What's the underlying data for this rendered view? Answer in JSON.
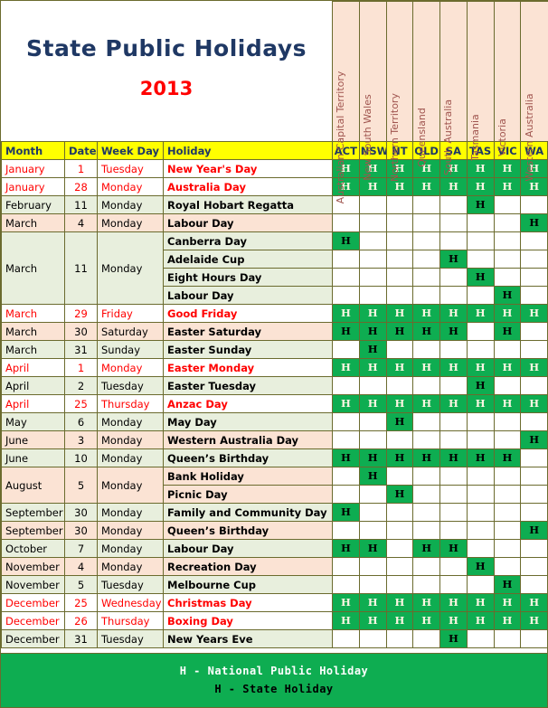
{
  "title": {
    "heading": "State Public Holidays",
    "year": "2013"
  },
  "states": [
    {
      "code": "ACT",
      "full": "Australian Capital Territory"
    },
    {
      "code": "NSW",
      "full": "New South Wales"
    },
    {
      "code": "NT",
      "full": "Northern Territory"
    },
    {
      "code": "QLD",
      "full": "Queensland"
    },
    {
      "code": "SA",
      "full": "South Australia"
    },
    {
      "code": "TAS",
      "full": "Tasmania"
    },
    {
      "code": "VIC",
      "full": "Victoria"
    },
    {
      "code": "WA",
      "full": "Western Australia"
    }
  ],
  "columns": {
    "month": "Month",
    "date": "Date",
    "weekday": "Week Day",
    "holiday": "Holiday"
  },
  "legend": {
    "national": "H - National Public Holiday",
    "state": "H - State Holiday",
    "marker": "H"
  },
  "colors": {
    "title": "#1f3864",
    "year": "#ff0000",
    "header_bg": "#ffff00",
    "holiday_green": "#0ead51",
    "row_green": "#e8efdd",
    "row_peach": "#fbe3d4",
    "national_text": "#ff0000",
    "state_header_text": "#a0554f",
    "border": "#6b6b2e"
  },
  "rows": [
    {
      "month": "January",
      "date": "1",
      "weekday": "Tuesday",
      "holiday": "New Year's Day",
      "national": true,
      "tone": "white",
      "marks": [
        1,
        1,
        1,
        1,
        1,
        1,
        1,
        1
      ]
    },
    {
      "month": "January",
      "date": "28",
      "weekday": "Monday",
      "holiday": "Australia Day",
      "national": true,
      "tone": "white",
      "marks": [
        1,
        1,
        1,
        1,
        1,
        1,
        1,
        1
      ]
    },
    {
      "month": "February",
      "date": "11",
      "weekday": "Monday",
      "holiday": "Royal Hobart Regatta",
      "national": false,
      "tone": "green",
      "marks": [
        0,
        0,
        0,
        0,
        0,
        1,
        0,
        0
      ]
    },
    {
      "month": "March",
      "date": "4",
      "weekday": "Monday",
      "holiday": "Labour Day",
      "national": false,
      "tone": "peach",
      "marks": [
        0,
        0,
        0,
        0,
        0,
        0,
        0,
        1
      ]
    },
    {
      "month": "March",
      "date": "11",
      "weekday": "Monday",
      "holiday": "Canberra Day",
      "national": false,
      "tone": "green",
      "marks": [
        1,
        0,
        0,
        0,
        0,
        0,
        0,
        0
      ],
      "merge_start": true,
      "merge_span": 4
    },
    {
      "month": "",
      "date": "",
      "weekday": "",
      "holiday": "Adelaide Cup",
      "national": false,
      "tone": "green",
      "marks": [
        0,
        0,
        0,
        0,
        1,
        0,
        0,
        0
      ],
      "merged": true
    },
    {
      "month": "",
      "date": "",
      "weekday": "",
      "holiday": "Eight Hours Day",
      "national": false,
      "tone": "green",
      "marks": [
        0,
        0,
        0,
        0,
        0,
        1,
        0,
        0
      ],
      "merged": true
    },
    {
      "month": "",
      "date": "",
      "weekday": "",
      "holiday": "Labour Day",
      "national": false,
      "tone": "green",
      "marks": [
        0,
        0,
        0,
        0,
        0,
        0,
        1,
        0
      ],
      "merged": true
    },
    {
      "month": "March",
      "date": "29",
      "weekday": "Friday",
      "holiday": "Good Friday",
      "national": true,
      "tone": "white",
      "marks": [
        1,
        1,
        1,
        1,
        1,
        1,
        1,
        1
      ]
    },
    {
      "month": "March",
      "date": "30",
      "weekday": "Saturday",
      "holiday": "Easter Saturday",
      "national": false,
      "tone": "peach",
      "marks": [
        1,
        1,
        1,
        1,
        1,
        0,
        1,
        0
      ]
    },
    {
      "month": "March",
      "date": "31",
      "weekday": "Sunday",
      "holiday": "Easter Sunday",
      "national": false,
      "tone": "green",
      "marks": [
        0,
        1,
        0,
        0,
        0,
        0,
        0,
        0
      ]
    },
    {
      "month": "April",
      "date": "1",
      "weekday": "Monday",
      "holiday": "Easter Monday",
      "national": true,
      "tone": "white",
      "marks": [
        1,
        1,
        1,
        1,
        1,
        1,
        1,
        1
      ]
    },
    {
      "month": "April",
      "date": "2",
      "weekday": "Tuesday",
      "holiday": "Easter Tuesday",
      "national": false,
      "tone": "green",
      "marks": [
        0,
        0,
        0,
        0,
        0,
        1,
        0,
        0
      ]
    },
    {
      "month": "April",
      "date": "25",
      "weekday": "Thursday",
      "holiday": "Anzac Day",
      "national": true,
      "tone": "white",
      "marks": [
        1,
        1,
        1,
        1,
        1,
        1,
        1,
        1
      ]
    },
    {
      "month": "May",
      "date": "6",
      "weekday": "Monday",
      "holiday": "May Day",
      "national": false,
      "tone": "green",
      "marks": [
        0,
        0,
        1,
        0,
        0,
        0,
        0,
        0
      ]
    },
    {
      "month": "June",
      "date": "3",
      "weekday": "Monday",
      "holiday": "Western Australia Day",
      "national": false,
      "tone": "peach",
      "marks": [
        0,
        0,
        0,
        0,
        0,
        0,
        0,
        1
      ]
    },
    {
      "month": "June",
      "date": "10",
      "weekday": "Monday",
      "holiday": "Queen’s Birthday",
      "national": false,
      "tone": "green",
      "marks": [
        1,
        1,
        1,
        1,
        1,
        1,
        1,
        0
      ]
    },
    {
      "month": "August",
      "date": "5",
      "weekday": "Monday",
      "holiday": "Bank Holiday",
      "national": false,
      "tone": "peach",
      "marks": [
        0,
        1,
        0,
        0,
        0,
        0,
        0,
        0
      ],
      "merge_start": true,
      "merge_span": 2
    },
    {
      "month": "",
      "date": "",
      "weekday": "",
      "holiday": "Picnic Day",
      "national": false,
      "tone": "peach",
      "marks": [
        0,
        0,
        1,
        0,
        0,
        0,
        0,
        0
      ],
      "merged": true
    },
    {
      "month": "September",
      "date": "30",
      "weekday": "Monday",
      "holiday": "Family and Community Day",
      "national": false,
      "tone": "green",
      "marks": [
        1,
        0,
        0,
        0,
        0,
        0,
        0,
        0
      ]
    },
    {
      "month": "September",
      "date": "30",
      "weekday": "Monday",
      "holiday": "Queen’s Birthday",
      "national": false,
      "tone": "peach",
      "marks": [
        0,
        0,
        0,
        0,
        0,
        0,
        0,
        1
      ]
    },
    {
      "month": "October",
      "date": "7",
      "weekday": "Monday",
      "holiday": "Labour Day",
      "national": false,
      "tone": "green",
      "marks": [
        1,
        1,
        0,
        1,
        1,
        0,
        0,
        0
      ]
    },
    {
      "month": "November",
      "date": "4",
      "weekday": "Monday",
      "holiday": "Recreation Day",
      "national": false,
      "tone": "peach",
      "marks": [
        0,
        0,
        0,
        0,
        0,
        1,
        0,
        0
      ]
    },
    {
      "month": "November",
      "date": "5",
      "weekday": "Tuesday",
      "holiday": "Melbourne Cup",
      "national": false,
      "tone": "green",
      "marks": [
        0,
        0,
        0,
        0,
        0,
        0,
        1,
        0
      ]
    },
    {
      "month": "December",
      "date": "25",
      "weekday": "Wednesday",
      "holiday": "Christmas Day",
      "national": true,
      "tone": "white",
      "marks": [
        1,
        1,
        1,
        1,
        1,
        1,
        1,
        1
      ]
    },
    {
      "month": "December",
      "date": "26",
      "weekday": "Thursday",
      "holiday": "Boxing Day",
      "national": true,
      "tone": "white",
      "marks": [
        1,
        1,
        1,
        1,
        1,
        1,
        1,
        1
      ]
    },
    {
      "month": "December",
      "date": "31",
      "weekday": "Tuesday",
      "holiday": "New Years Eve",
      "national": false,
      "tone": "green",
      "marks": [
        0,
        0,
        0,
        0,
        1,
        0,
        0,
        0
      ]
    }
  ]
}
